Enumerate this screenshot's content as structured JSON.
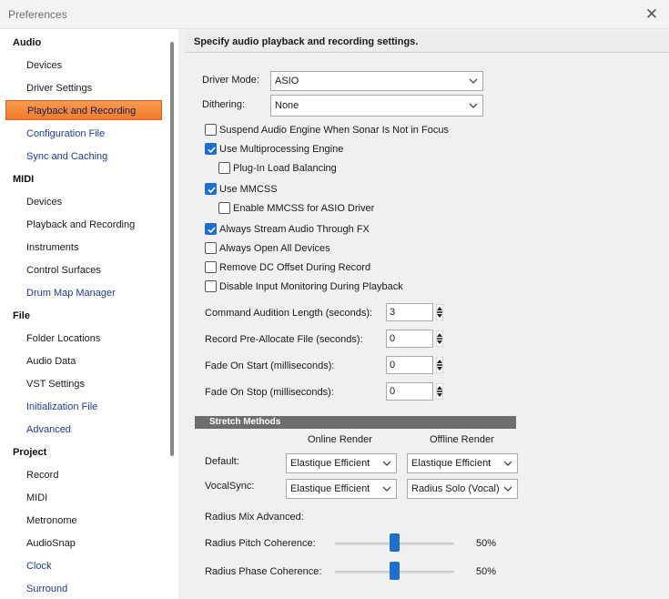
{
  "window": {
    "title": "Preferences"
  },
  "sidebar": {
    "categories": {
      "audio": "Audio",
      "midi": "MIDI",
      "file": "File",
      "project": "Project"
    },
    "audio_items": [
      "Devices",
      "Driver Settings",
      "Playback and Recording",
      "Configuration File",
      "Sync and Caching"
    ],
    "midi_items": [
      "Devices",
      "Playback and Recording",
      "Instruments",
      "Control Surfaces",
      "Drum Map Manager"
    ],
    "file_items": [
      "Folder Locations",
      "Audio Data",
      "VST Settings",
      "Initialization File",
      "Advanced"
    ],
    "project_items": [
      "Record",
      "MIDI",
      "Metronome",
      "AudioSnap",
      "Clock",
      "Surround"
    ],
    "selected": "Playback and Recording",
    "selection_color": "#f07b29"
  },
  "header": {
    "text": "Specify audio playback and recording settings."
  },
  "driver": {
    "mode_label": "Driver Mode:",
    "mode_value": "ASIO",
    "dither_label": "Dithering:",
    "dither_value": "None"
  },
  "checkboxes": {
    "suspend": {
      "label": "Suspend Audio Engine When Sonar Is Not in Focus",
      "checked": false
    },
    "multiproc": {
      "label": "Use Multiprocessing Engine",
      "checked": true
    },
    "plugin_lb": {
      "label": "Plug-In Load Balancing",
      "checked": false
    },
    "mmcss": {
      "label": "Use MMCSS",
      "checked": true
    },
    "mmcss_asio": {
      "label": "Enable MMCSS for ASIO Driver",
      "checked": false
    },
    "always_stream": {
      "label": "Always Stream Audio Through FX",
      "checked": true
    },
    "always_open": {
      "label": "Always Open All Devices",
      "checked": false
    },
    "remove_dc": {
      "label": "Remove DC Offset During Record",
      "checked": false
    },
    "disable_monitor": {
      "label": "Disable Input Monitoring During Playback",
      "checked": false
    }
  },
  "spinners": {
    "audition": {
      "label": "Command Audition Length (seconds):",
      "value": "3"
    },
    "preallocate": {
      "label": "Record Pre-Allocate File (seconds):",
      "value": "0"
    },
    "fade_start": {
      "label": "Fade On Start  (milliseconds):",
      "value": "0"
    },
    "fade_stop": {
      "label": "Fade On Stop  (milliseconds):",
      "value": "0"
    }
  },
  "stretch": {
    "section_title": "Stretch Methods",
    "col_online": "Online Render",
    "col_offline": "Offline Render",
    "default_label": "Default:",
    "default_online": "Elastique Efficient",
    "default_offline": "Elastique Efficient",
    "vocalsync_label": "VocalSync:",
    "vocalsync_online": "Elastique Efficient",
    "vocalsync_offline": "Radius Solo (Vocal)",
    "radius_mix_label": "Radius Mix Advanced:",
    "pitch_label": "Radius Pitch Coherence:",
    "pitch_value": "50%",
    "pitch_level": 0.5,
    "phase_label": "Radius Phase Coherence:",
    "phase_value": "50%",
    "phase_level": 0.5
  },
  "accent_color": "#1f6fd0"
}
